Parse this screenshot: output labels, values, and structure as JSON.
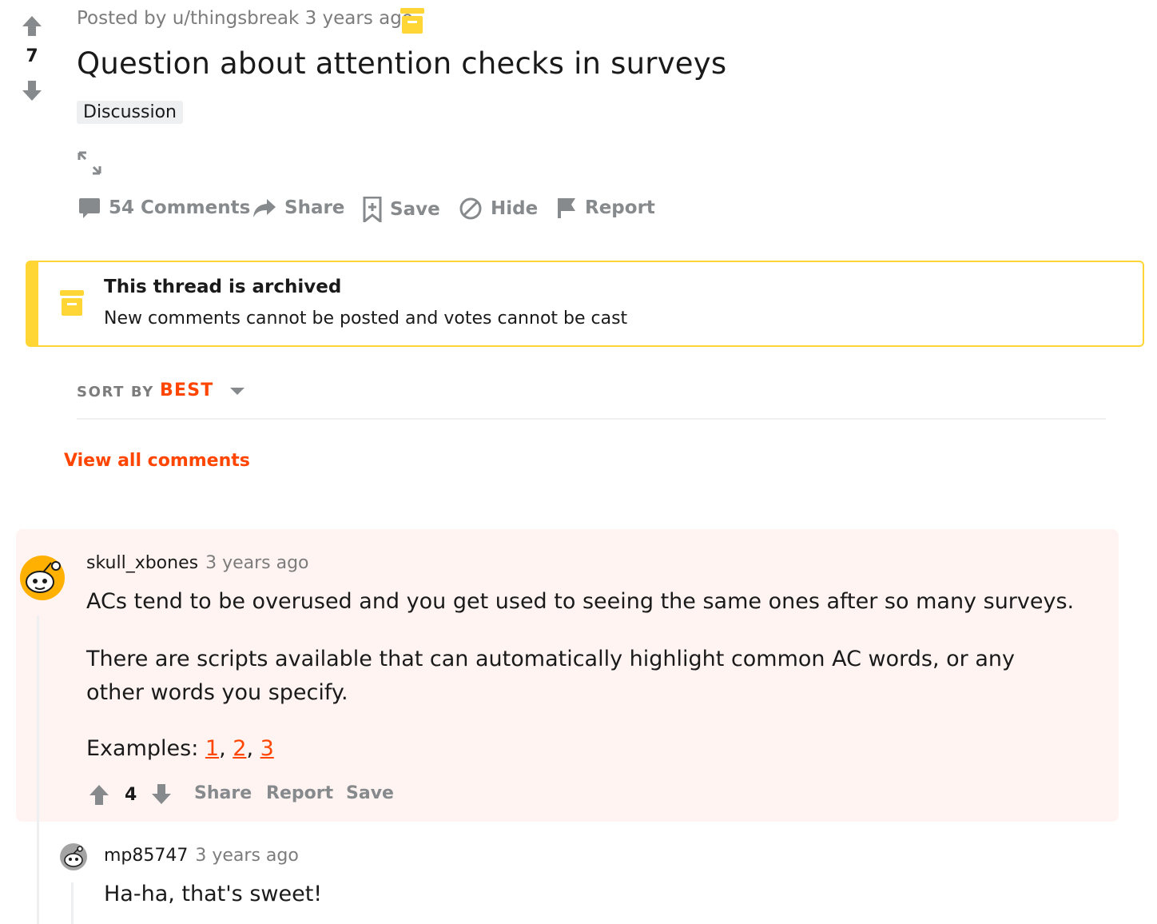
{
  "post": {
    "score": "7",
    "meta": "Posted by u/thingsbreak 3 years ago",
    "title": "Question about attention checks in surveys",
    "flair": "Discussion",
    "actions": {
      "comments": "54 Comments",
      "share": "Share",
      "save": "Save",
      "hide": "Hide",
      "report": "Report"
    }
  },
  "archived": {
    "title": "This thread is archived",
    "subtitle": "New comments cannot be posted and votes cannot be cast"
  },
  "sort": {
    "label": "SORT BY",
    "value": "BEST"
  },
  "view_all": "View all comments",
  "comments": [
    {
      "author": "skull_xbones",
      "time": "3 years ago",
      "paragraphs": [
        "ACs tend to be overused and you get used to seeing the same ones after so many surveys.",
        "There are scripts available that can automatically highlight common AC words, or any other words you specify."
      ],
      "examples_label": "Examples: ",
      "example_links": [
        "1",
        "2",
        "3"
      ],
      "score": "4",
      "actions": {
        "share": "Share",
        "report": "Report",
        "save": "Save"
      }
    },
    {
      "author": "mp85747",
      "time": "3 years ago",
      "body": "Ha-ha, that's sweet!"
    }
  ],
  "colors": {
    "accent": "#ff4500",
    "archive_yellow": "#ffd635",
    "highlight_bg": "#fff4f1",
    "muted": "#878a8c"
  }
}
